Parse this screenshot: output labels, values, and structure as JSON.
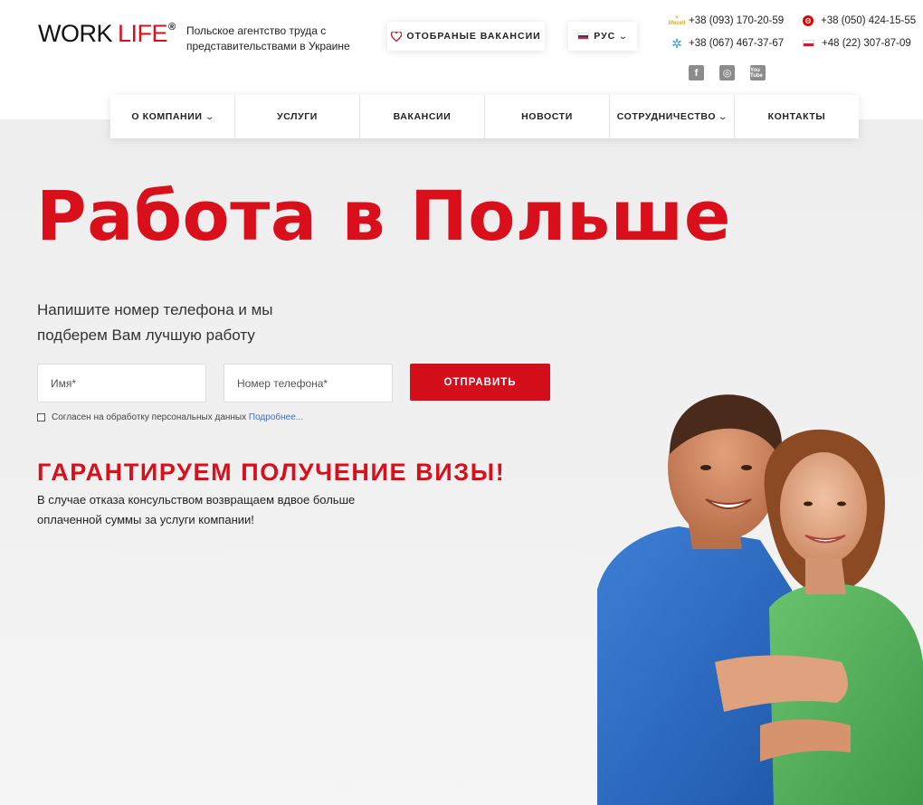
{
  "header": {
    "logo_work": "WORK",
    "logo_life": "LIFE",
    "logo_reg": "®",
    "tagline": "Польское агентство труда с представительствами в Украине",
    "favorites_label": "ОТОБРАНЫЕ ВАКАНСИИ",
    "language": "РУС",
    "phones_left": [
      {
        "operator": "lifecell",
        "number": "+38 (093) 170-20-59"
      },
      {
        "operator": "kyivstar",
        "number": "+38 (067) 467-37-67"
      }
    ],
    "phones_right": [
      {
        "operator": "vodafone",
        "number": "+38 (050) 424-15-55"
      },
      {
        "operator": "poland",
        "number": "+48 (22) 307-87-09"
      }
    ],
    "socials": [
      "f",
      "◎",
      "You Tube"
    ]
  },
  "nav": {
    "items": [
      {
        "label": "О КОМПАНИИ",
        "has_dropdown": true
      },
      {
        "label": "УСЛУГИ",
        "has_dropdown": false
      },
      {
        "label": "ВАКАНСИИ",
        "has_dropdown": false
      },
      {
        "label": "НОВОСТИ",
        "has_dropdown": false
      },
      {
        "label": "СОТРУДНИЧЕСТВО",
        "has_dropdown": true
      },
      {
        "label": "КОНТАКТЫ",
        "has_dropdown": false
      }
    ]
  },
  "hero": {
    "title": "Работа в Польше",
    "subtitle": "Напишите номер телефона и мы подберем Вам лучшую работу",
    "name_placeholder": "Имя*",
    "phone_placeholder": "Номер телефона*",
    "submit_label": "ОТПРАВИТЬ",
    "consent_text": "Согласен на обработку персональных данных",
    "consent_link": "Подробнее...",
    "visa_title": "ГАРАНТИРУЕМ ПОЛУЧЕНИЕ ВИЗЫ!",
    "visa_text": "В случае отказа консульством возвращаем вдвое больше оплаченной суммы за услуги компании!"
  },
  "colors": {
    "brand_red": "#d9101b",
    "link_blue": "#3a6ec9"
  }
}
